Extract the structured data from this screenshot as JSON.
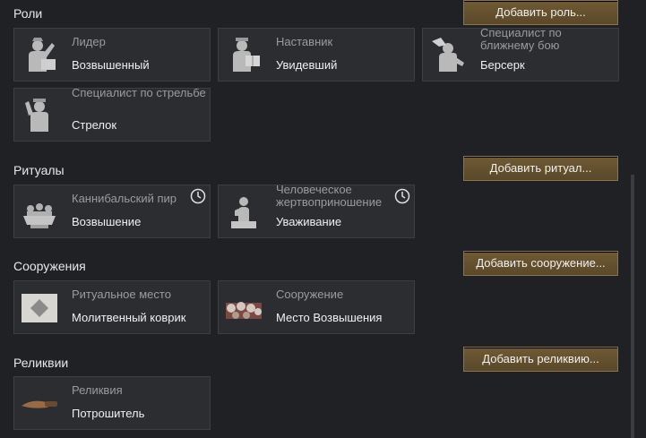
{
  "sections": {
    "roles": {
      "title": "Роли",
      "add_label": "Добавить роль..."
    },
    "rituals": {
      "title": "Ритуалы",
      "add_label": "Добавить ритуал..."
    },
    "buildings": {
      "title": "Сооружения",
      "add_label": "Добавить сооружение..."
    },
    "relics": {
      "title": "Реликвии",
      "add_label": "Добавить реликвию..."
    }
  },
  "roles": [
    {
      "label": "Лидер",
      "value": "Возвышенный",
      "icon": "leader-icon"
    },
    {
      "label": "Наставник",
      "value": "Увидевший",
      "icon": "mentor-icon"
    },
    {
      "label": "Специалист по ближнему бою",
      "value": "Берсерк",
      "icon": "melee-specialist-icon"
    },
    {
      "label": "Специалист по стрельбе",
      "value": "Стрелок",
      "icon": "shooting-specialist-icon"
    }
  ],
  "rituals": [
    {
      "label": "Каннибальский пир",
      "value": "Возвышение",
      "icon": "cannibal-feast-icon"
    },
    {
      "label": "Человеческое жертвоприношение",
      "value": "Уваживание",
      "icon": "human-sacrifice-icon"
    }
  ],
  "buildings": [
    {
      "label": "Ритуальное место",
      "value": "Молитвенный коврик",
      "icon": "prayer-rug-icon"
    },
    {
      "label": "Сооружение",
      "value": "Место Возвышения",
      "icon": "ascension-site-icon"
    }
  ],
  "relics": [
    {
      "label": "Реликвия",
      "value": "Потрошитель",
      "icon": "knife-relic-icon"
    }
  ]
}
